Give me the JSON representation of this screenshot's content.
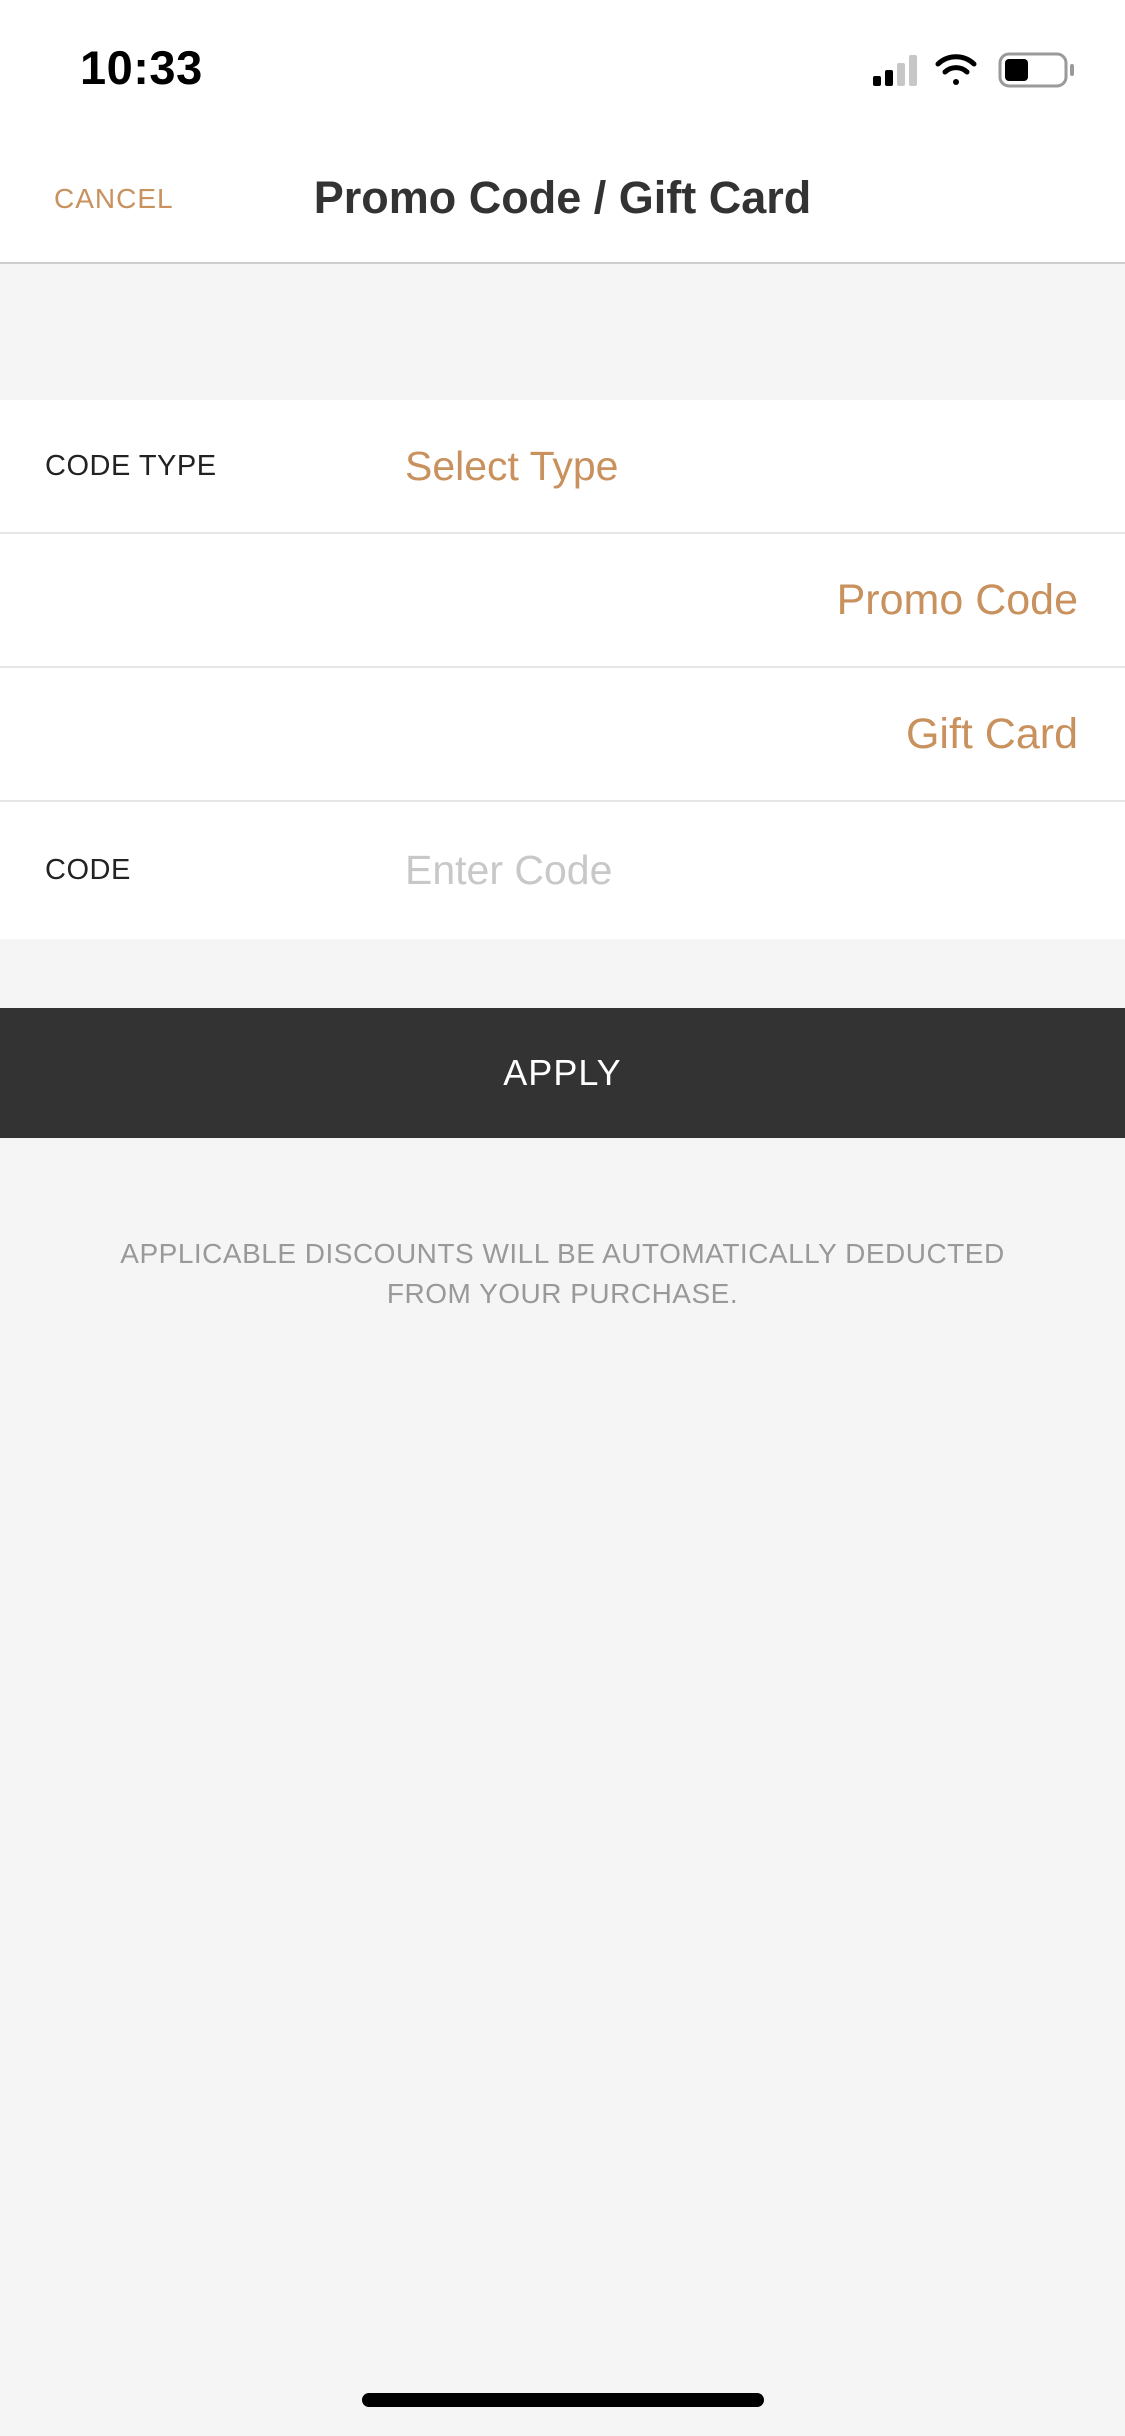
{
  "status_bar": {
    "time": "10:33",
    "icons": [
      "cellular-signal-icon",
      "wifi-icon",
      "battery-icon"
    ]
  },
  "nav": {
    "cancel_label": "CANCEL",
    "title": "Promo Code / Gift Card"
  },
  "form": {
    "code_type": {
      "label": "CODE TYPE",
      "value": "Select Type"
    },
    "options": [
      {
        "label": "Promo Code"
      },
      {
        "label": "Gift Card"
      }
    ],
    "code": {
      "label": "CODE",
      "value": "",
      "placeholder": "Enter Code"
    }
  },
  "apply_label": "APPLY",
  "disclaimer": "APPLICABLE DISCOUNTS WILL BE AUTOMATICALLY DEDUCTED FROM YOUR PURCHASE.",
  "colors": {
    "accent": "#c8915d",
    "button_bg": "#333333",
    "background": "#f5f5f5",
    "placeholder": "#c8c8c8",
    "muted_text": "#999999"
  }
}
